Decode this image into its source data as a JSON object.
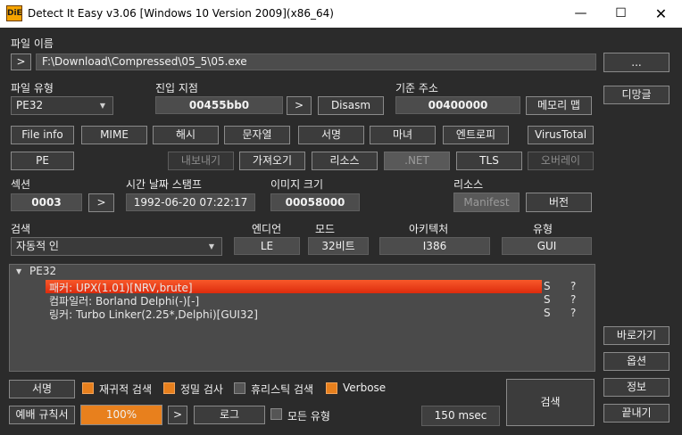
{
  "window": {
    "title": "Detect It Easy v3.06 [Windows 10 Version 2009](x86_64)",
    "app_icon_text": "DiE"
  },
  "file": {
    "label": "파일 이름",
    "expand": ">",
    "path": "F:\\Download\\Compressed\\05_5\\05.exe",
    "browse": "..."
  },
  "file_type": {
    "label": "파일 유형",
    "value": "PE32"
  },
  "entry_point": {
    "label": "진입 지점",
    "value": "00455bb0",
    "go": ">",
    "disasm": "Disasm"
  },
  "base_address": {
    "label": "기준 주소",
    "value": "00400000",
    "memory_map": "메모리 맵"
  },
  "side": {
    "demangle": "디망글",
    "goto": "바로가기",
    "options": "옵션",
    "about": "정보",
    "exit": "끝내기"
  },
  "row1": [
    "File info",
    "MIME",
    "해시",
    "문자열",
    "서명",
    "마녀",
    "엔트로피",
    "VirusTotal"
  ],
  "row2": {
    "pe": "PE",
    "export": "내보내기",
    "import": "가져오기",
    "resources": "리소스",
    "net": ".NET",
    "tls": "TLS",
    "overlay": "오버레이"
  },
  "sections": {
    "label": "섹션",
    "value": "0003",
    "go": ">"
  },
  "timestamp": {
    "label": "시간 날짜 스탬프",
    "value": "1992-06-20 07:22:17"
  },
  "image_size": {
    "label": "이미지 크기",
    "value": "00058000"
  },
  "resources": {
    "label": "리소스",
    "manifest": "Manifest",
    "version": "버전"
  },
  "scan": {
    "label": "검색",
    "mode_value": "자동적 인"
  },
  "endian": {
    "label": "엔디언",
    "value": "LE"
  },
  "mode": {
    "label": "모드",
    "value": "32비트"
  },
  "arch": {
    "label": "아키텍처",
    "value": "I386"
  },
  "type": {
    "label": "유형",
    "value": "GUI"
  },
  "results": {
    "root": "PE32",
    "items": [
      {
        "text": "패커: UPX(1.01)[NRV,brute]",
        "s": "S",
        "q": "?"
      },
      {
        "text": "컴파일러: Borland Delphi(-)[-]",
        "s": "S",
        "q": "?"
      },
      {
        "text": "링커: Turbo Linker(2.25*,Delphi)[GUI32]",
        "s": "S",
        "q": "?"
      }
    ]
  },
  "bottom": {
    "signatures": "서명",
    "recursive": "재귀적 검색",
    "deep": "정밀 검사",
    "heuristic": "휴리스틱 검색",
    "verbose": "Verbose",
    "scan_button": "검색",
    "rules": "예배 규칙서",
    "progress": "100%",
    "progress_value": 1.0,
    "go": ">",
    "log": "로그",
    "all_types": "모든 유형",
    "elapsed": "150 msec"
  },
  "colors": {
    "accent": "#e8801d",
    "selection": "#e8401a",
    "bg": "#2b2b2b"
  }
}
